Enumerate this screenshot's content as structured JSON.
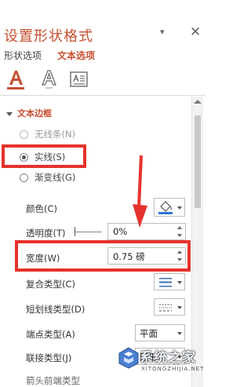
{
  "panel": {
    "title": "设置形状格式",
    "pin_glyph": "▾",
    "close_glyph": "✕"
  },
  "tabs": {
    "shape_options": "形状选项",
    "text_options": "文本选项"
  },
  "section": {
    "title": "文本边框"
  },
  "line_options": [
    {
      "label": "无线条(N)",
      "checked": false
    },
    {
      "label": "实线(S)",
      "checked": true
    },
    {
      "label": "渐变线(G)",
      "checked": false
    }
  ],
  "props": {
    "color_label": "颜色(C)",
    "transparency_label": "透明度(T)",
    "transparency_value": "0%",
    "width_label": "宽度(W)",
    "width_value": "0.75 磅",
    "compound_label": "复合类型(C)",
    "dash_label": "短划线类型(D)",
    "cap_label": "端点类型(A)",
    "cap_value": "平面",
    "join_label": "联接类型(J)",
    "join_value": "圆形",
    "arrow_start_label": "箭头前端类型"
  },
  "colors": {
    "accent": "#c65031",
    "annotation_red": "#e5322d",
    "bucket_blue": "#2e75d6"
  },
  "watermark": {
    "text": "系统之家",
    "sub": "XITONGZHIJIA.NET"
  }
}
